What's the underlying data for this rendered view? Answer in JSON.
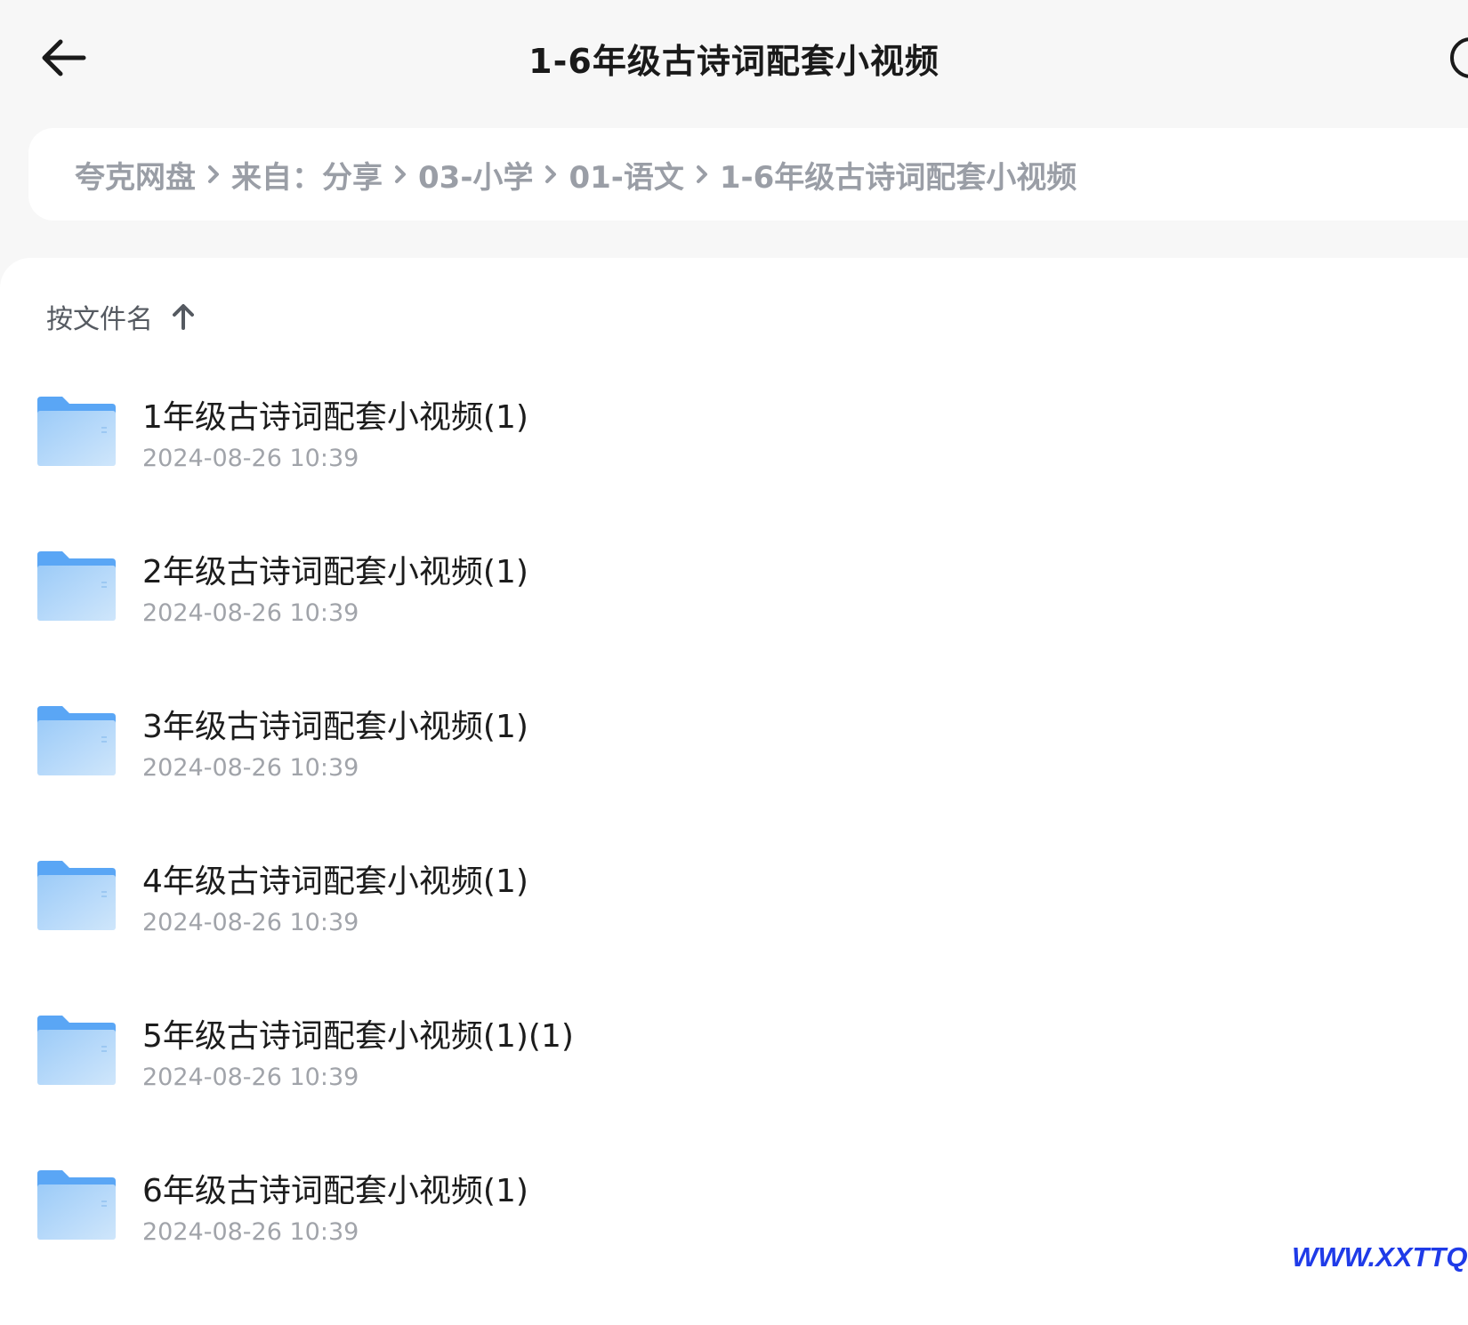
{
  "header": {
    "title": "1-6年级古诗词配套小视频"
  },
  "breadcrumb": [
    "夸克网盘",
    "来自：分享",
    "03-小学",
    "01-语文",
    "1-6年级古诗词配套小视频"
  ],
  "sort": {
    "label": "按文件名",
    "direction": "ascending"
  },
  "files": [
    {
      "name": "1年级古诗词配套小视频(1)",
      "date": "2024-08-26 10:39",
      "type": "folder"
    },
    {
      "name": "2年级古诗词配套小视频(1)",
      "date": "2024-08-26 10:39",
      "type": "folder"
    },
    {
      "name": "3年级古诗词配套小视频(1)",
      "date": "2024-08-26 10:39",
      "type": "folder"
    },
    {
      "name": "4年级古诗词配套小视频(1)",
      "date": "2024-08-26 10:39",
      "type": "folder"
    },
    {
      "name": "5年级古诗词配套小视频(1)(1)",
      "date": "2024-08-26 10:39",
      "type": "folder"
    },
    {
      "name": "6年级古诗词配套小视频(1)",
      "date": "2024-08-26 10:39",
      "type": "folder"
    }
  ],
  "watermark": "WWW.XXTTQ.COM",
  "colors": {
    "folder": "#5aa6f5",
    "folder_light": "#b9daf9",
    "watermark": "#1f3be8"
  }
}
